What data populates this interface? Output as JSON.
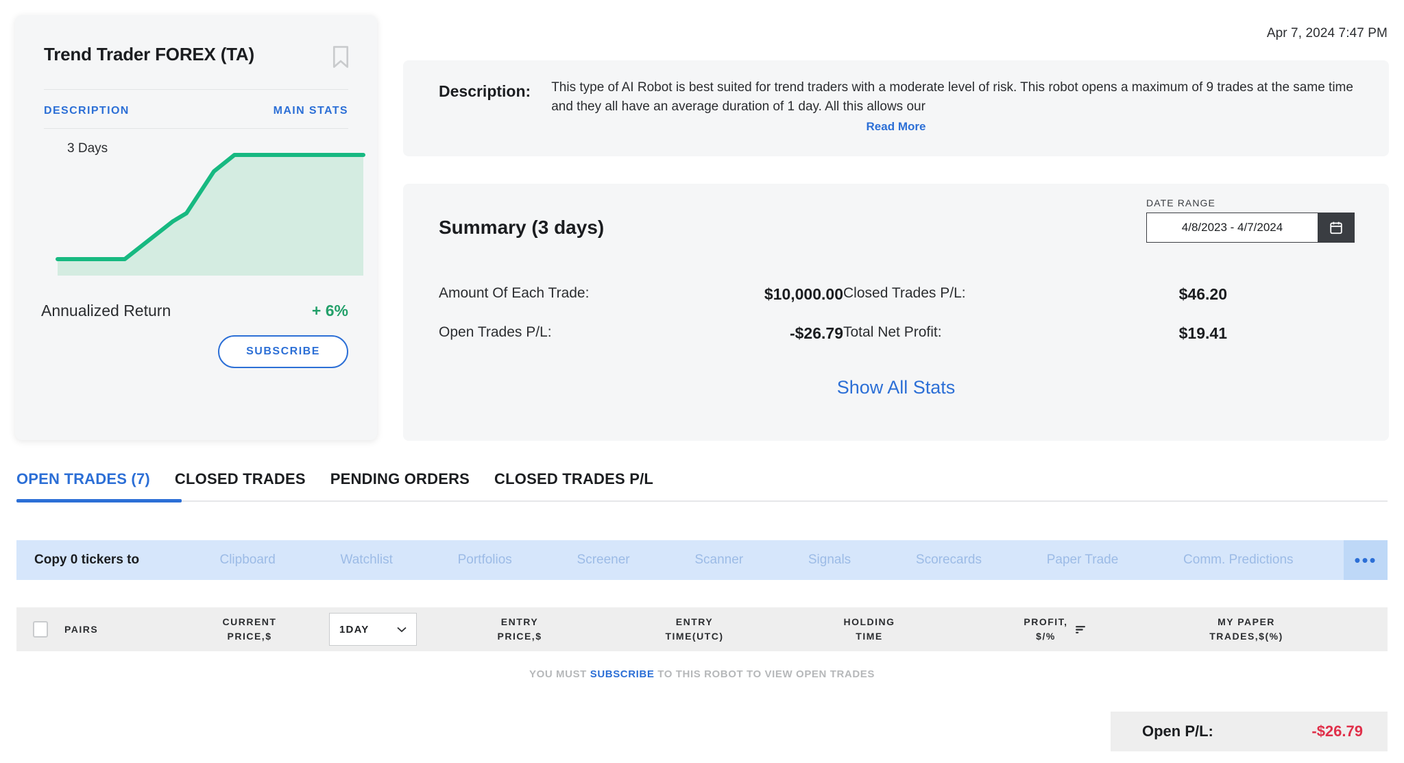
{
  "timestamp": "Apr 7, 2024 7:47 PM",
  "robot_card": {
    "title": "Trend Trader FOREX (TA)",
    "bookmark_icon": "bookmark-icon",
    "tabs": [
      {
        "label": "DESCRIPTION"
      },
      {
        "label": "MAIN STATS"
      }
    ],
    "chart_period_label": "3 Days",
    "return_label": "Annualized Return",
    "return_value": "+ 6%",
    "subscribe_label": "SUBSCRIBE"
  },
  "description": {
    "label": "Description:",
    "text": "This type of AI Robot is best suited for trend traders with a moderate level of risk. This robot opens a maximum of 9 trades at the same time and they all have an average duration of 1 day. All this allows our",
    "read_more": "Read More"
  },
  "summary": {
    "title": "Summary (3 days)",
    "date_range_label": "DATE RANGE",
    "date_range_value": "4/8/2023 - 4/7/2024",
    "calendar_icon": "calendar-icon",
    "stats": [
      {
        "label": "Amount Of Each Trade:",
        "value": "$10,000.00"
      },
      {
        "label": "Closed Trades P/L:",
        "value": "$46.20"
      },
      {
        "label": "Open Trades P/L:",
        "value": "-$26.79"
      },
      {
        "label": "Total Net Profit:",
        "value": "$19.41"
      }
    ],
    "show_all_stats": "Show All Stats"
  },
  "main_tabs": [
    {
      "label": "OPEN TRADES (7)",
      "active": true
    },
    {
      "label": "CLOSED TRADES",
      "active": false
    },
    {
      "label": "PENDING ORDERS",
      "active": false
    },
    {
      "label": "CLOSED TRADES P/L",
      "active": false
    }
  ],
  "copy_bar": {
    "label": "Copy 0 tickers to",
    "targets": [
      "Clipboard",
      "Watchlist",
      "Portfolios",
      "Screener",
      "Scanner",
      "Signals",
      "Scorecards",
      "Paper Trade",
      "Comm. Predictions"
    ],
    "more": "•••"
  },
  "table": {
    "columns": [
      "PAIRS",
      "CURRENT\nPRICE,$",
      "ENTRY\nPRICE,$",
      "ENTRY\nTIME(UTC)",
      "HOLDING\nTIME",
      "PROFIT,\n$/%",
      "MY PAPER\nTRADES,$(%)"
    ],
    "period_select_value": "1DAY",
    "sort_icon": "sort-icon",
    "checkbox_icon": "checkbox-unchecked-icon"
  },
  "subscribe_notice": {
    "prefix": "YOU MUST ",
    "link": "SUBSCRIBE",
    "suffix": " TO THIS ROBOT TO VIEW OPEN TRADES"
  },
  "open_pl": {
    "label": "Open P/L:",
    "value": "-$26.79"
  },
  "colors": {
    "accent_blue": "#2c6fd6",
    "green": "#23a06a",
    "chart_fill": "#d4ece1",
    "red": "#e0304a",
    "panel_bg": "#f5f6f7",
    "copy_bar_bg": "#d6e6fb"
  },
  "chart_data": {
    "type": "area",
    "title": "3 Days",
    "x": [
      0,
      1,
      2,
      3,
      4,
      5,
      6
    ],
    "values": [
      6,
      6,
      18,
      34,
      42,
      100,
      100
    ],
    "xlabel": "",
    "ylabel": "",
    "ylim": [
      0,
      110
    ],
    "grid": false,
    "legend": "none",
    "line_color": "#17b981",
    "fill_color": "#d4ece1"
  }
}
